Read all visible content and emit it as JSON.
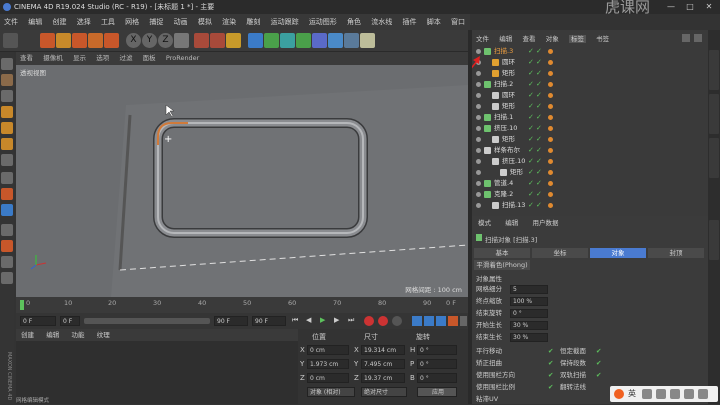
{
  "title": "CINEMA 4D R19.024 Studio (RC - R19) - [未标题 1 *] - 主要",
  "watermark": "虎课网",
  "window_controls": [
    "—",
    "□",
    "✕"
  ],
  "menu": [
    "文件",
    "编辑",
    "创建",
    "选择",
    "工具",
    "网格",
    "捕捉",
    "动画",
    "模拟",
    "渲染",
    "雕刻",
    "运动跟踪",
    "运动图形",
    "角色",
    "流水线",
    "插件",
    "脚本",
    "窗口",
    "帮助"
  ],
  "toolbar_axes": [
    "X",
    "Y",
    "Z"
  ],
  "viewport_menu": [
    "查看",
    "摄像机",
    "显示",
    "选项",
    "过滤",
    "面板",
    "ProRender"
  ],
  "viewport": {
    "label": "透视视图",
    "grid_spacing": "网格间距 : 100 cm"
  },
  "timeline": {
    "ticks": [
      "0",
      "10",
      "20",
      "30",
      "40",
      "50",
      "60",
      "70",
      "80",
      "90"
    ],
    "start": "0 F",
    "current": "0 F",
    "end": "90 F",
    "end2": "90 F",
    "frame_display": "0 F"
  },
  "material_menu": [
    "创建",
    "编辑",
    "功能",
    "纹理"
  ],
  "coords": {
    "headers": [
      "位置",
      "尺寸",
      "旋转"
    ],
    "rows": [
      {
        "axis": "X",
        "pos": "0 cm",
        "size_axis": "X",
        "size": "19.314 cm",
        "rot_axis": "H",
        "rot": "0 °"
      },
      {
        "axis": "Y",
        "pos": "1.973 cm",
        "size_axis": "Y",
        "size": "7.495 cm",
        "rot_axis": "P",
        "rot": "0 °"
      },
      {
        "axis": "Z",
        "pos": "0 cm",
        "size_axis": "Z",
        "size": "19.37 cm",
        "rot_axis": "B",
        "rot": "0 °"
      }
    ],
    "mode1": "对象 (相对)",
    "mode2": "绝对尺寸",
    "apply": "应用"
  },
  "object_menu": [
    "文件",
    "编辑",
    "查看",
    "对象",
    "标签",
    "书签"
  ],
  "objects": [
    {
      "name": "扫描.3",
      "indent": 0,
      "selected": true,
      "color": "#6ec26e"
    },
    {
      "name": "圆环",
      "indent": 1,
      "selected": false,
      "color": "#e0a030"
    },
    {
      "name": "矩形",
      "indent": 1,
      "selected": false,
      "color": "#e0a030"
    },
    {
      "name": "扫描.2",
      "indent": 0,
      "selected": false,
      "color": "#6ec26e"
    },
    {
      "name": "圆环",
      "indent": 1,
      "selected": false,
      "color": "#ccc"
    },
    {
      "name": "矩形",
      "indent": 1,
      "selected": false,
      "color": "#ccc"
    },
    {
      "name": "扫描.1",
      "indent": 0,
      "selected": false,
      "color": "#6ec26e"
    },
    {
      "name": "挤压.10",
      "indent": 0,
      "selected": false,
      "color": "#6ec26e"
    },
    {
      "name": "矩形",
      "indent": 1,
      "selected": false,
      "color": "#ccc"
    },
    {
      "name": "样条布尔",
      "indent": 0,
      "selected": false,
      "color": "#ccc"
    },
    {
      "name": "挤压.10",
      "indent": 1,
      "selected": false,
      "color": "#ccc"
    },
    {
      "name": "矩形",
      "indent": 2,
      "selected": false,
      "color": "#ccc"
    },
    {
      "name": "管道.4",
      "indent": 0,
      "selected": false,
      "color": "#6ec26e"
    },
    {
      "name": "克隆.2",
      "indent": 0,
      "selected": false,
      "color": "#6ec26e"
    },
    {
      "name": "扫描.13",
      "indent": 1,
      "selected": false,
      "color": "#ccc"
    }
  ],
  "attr_menu": [
    "模式",
    "编辑",
    "用户数据"
  ],
  "attr_title": "扫描对象 [扫描.3]",
  "attr_tabs": [
    "基本",
    "坐标",
    "对象",
    "封顶"
  ],
  "attr_active_tab": "对象",
  "attr_subtab": "平滑着色(Phong)",
  "attr_section": "对象属性",
  "props": [
    {
      "label": "网格细分",
      "value": "5"
    },
    {
      "label": "终点缩放",
      "value": "100 %"
    },
    {
      "label": "结束旋转",
      "value": "0 °"
    },
    {
      "label": "开始生长",
      "value": "30 %"
    },
    {
      "label": "结束生长",
      "value": "30 %"
    }
  ],
  "checks": [
    {
      "left": "平行移动",
      "right": "恒定截面"
    },
    {
      "left": "矫正扭曲",
      "right": "保持段数"
    },
    {
      "left": "使用围栏方向",
      "right": "双轨扫描"
    },
    {
      "left": "使用围栏比例",
      "right": "翻转法线"
    }
  ],
  "more": "粘滞UV",
  "status": "网格编辑模式",
  "left_vertical": "MAXON CINEMA 4D",
  "ime": "英"
}
